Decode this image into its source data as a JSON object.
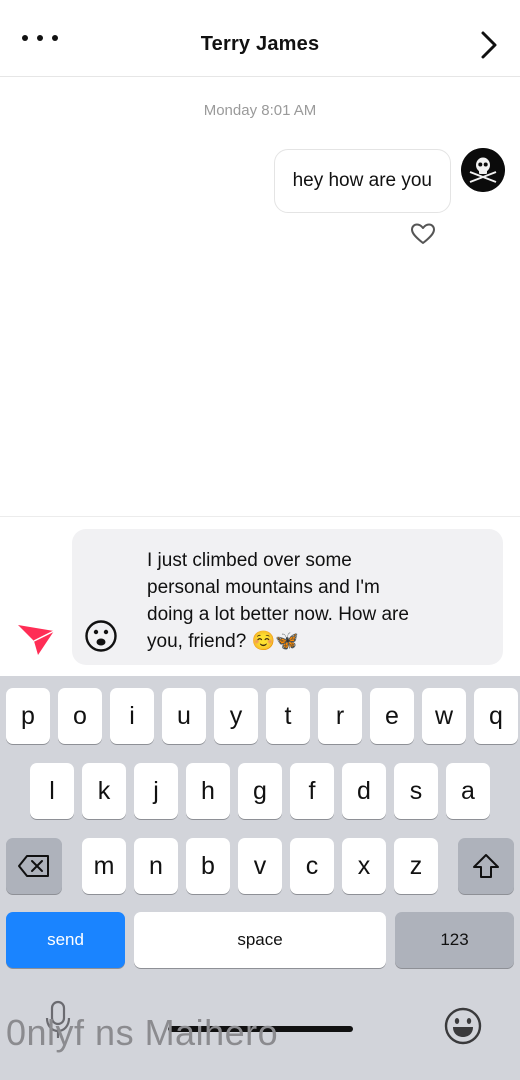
{
  "header": {
    "title": "Terry James",
    "more_icon": "more-horizontal-icon",
    "back_icon": "chevron-right-icon"
  },
  "chat": {
    "timestamp": "Monday 8:01 AM",
    "message_text": "hey how are you",
    "avatar_icon": "skull-crossbones-icon",
    "like_icon": "heart-outline-icon"
  },
  "composer": {
    "text": "I just climbed over some\npersonal mountains and I'm\ndoing a lot better now. How are\nyou, friend? ☺️🦋",
    "emoji_icon": "smiley-face-icon",
    "send_icon": "paper-plane-icon",
    "send_color": "#ff2d55"
  },
  "keyboard": {
    "row1": [
      "p",
      "o",
      "i",
      "u",
      "y",
      "t",
      "r",
      "e",
      "w",
      "q"
    ],
    "row2": [
      "l",
      "k",
      "j",
      "h",
      "g",
      "f",
      "d",
      "s",
      "a"
    ],
    "row3": [
      "m",
      "n",
      "b",
      "v",
      "c",
      "x",
      "z"
    ],
    "send_label": "send",
    "space_label": "space",
    "numbers_label": "123",
    "delete_icon": "backspace-icon",
    "shift_icon": "shift-arrow-icon",
    "mic_icon": "microphone-icon",
    "emoji_icon": "emoji-keyboard-icon",
    "accent_color": "#1a84ff"
  },
  "watermark": "0nlyf ns Maihero"
}
